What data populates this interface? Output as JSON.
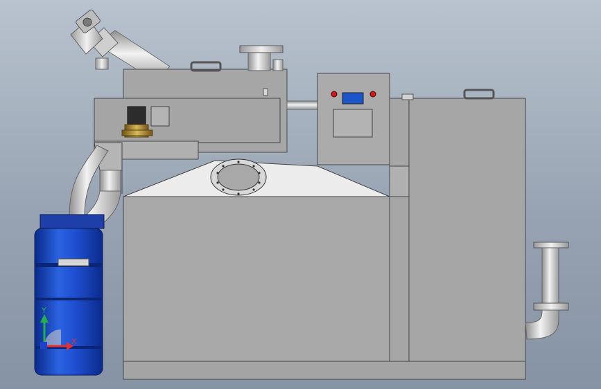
{
  "axis_triad": {
    "x_label": "X",
    "y_label": "Y",
    "x_color": "#e03030",
    "y_color": "#22b14c",
    "z_color": "#2040d0"
  },
  "colors": {
    "steel_panel": "#a9a9a9",
    "steel_dark": "#8c8c8c",
    "pipe_light": "#dcdcdc",
    "barrel_blue": "#1f4fd0",
    "display_blue": "#1c55c8",
    "indicator_red": "#d01818",
    "valve_brass": "#9a7a2a"
  },
  "icons": [
    "axis-triad-icon",
    "solenoid-valve-icon",
    "indicator-light-icon"
  ]
}
